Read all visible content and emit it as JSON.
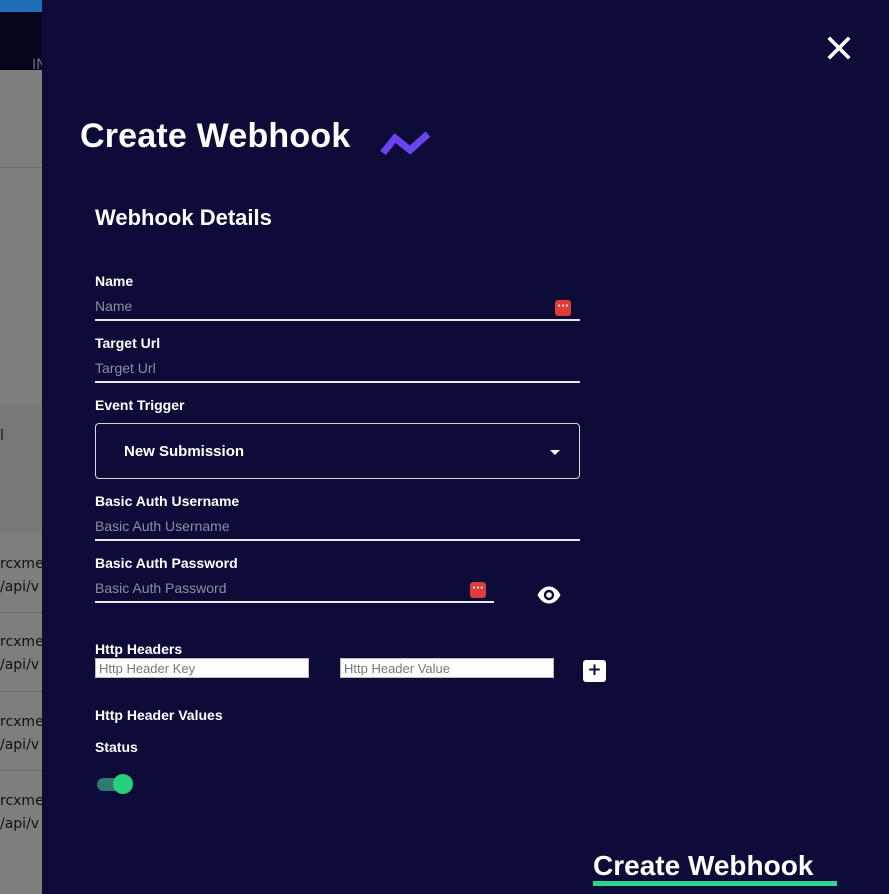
{
  "background": {
    "nav_partial": "IN",
    "rows_partial": [
      {
        "line1": "",
        "line2": "l"
      },
      {
        "line1": "rcxmec",
        "line2": "/api/v"
      },
      {
        "line1": "rcxmec",
        "line2": "/api/v"
      },
      {
        "line1": "rcxmec",
        "line2": "/api/v"
      },
      {
        "line1": "rcxmec",
        "line2": "/api/v"
      }
    ]
  },
  "panel": {
    "title": "Create Webhook",
    "close_icon": "close-icon",
    "logo_icon": "brand-zigzag-logo"
  },
  "form": {
    "section_title": "Webhook Details",
    "name": {
      "label": "Name",
      "placeholder": "Name",
      "value": ""
    },
    "target_url": {
      "label": "Target Url",
      "placeholder": "Target Url",
      "value": ""
    },
    "event_trigger": {
      "label": "Event Trigger",
      "selected": "New Submission"
    },
    "basic_auth_username": {
      "label": "Basic Auth Username",
      "placeholder": "Basic Auth Username",
      "value": ""
    },
    "basic_auth_password": {
      "label": "Basic Auth Password",
      "placeholder": "Basic Auth Password",
      "value": ""
    },
    "http_headers": {
      "label": "Http Headers",
      "key_placeholder": "Http Header Key",
      "value_placeholder": "Http Header Value",
      "add_label": "+"
    },
    "http_header_values": {
      "label": "Http Header Values"
    },
    "status": {
      "label": "Status",
      "enabled": true
    }
  },
  "submit": {
    "label": "Create Webhook"
  },
  "colors": {
    "panel_bg": "#0d0c38",
    "accent_purple": "#6b44f0",
    "accent_green": "#2dd48f",
    "toggle_thumb": "#26d07c",
    "password_badge": "#de3b3b"
  }
}
